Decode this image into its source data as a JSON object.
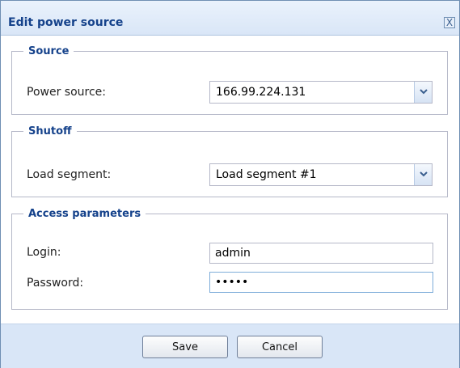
{
  "dialog": {
    "title": "Edit power source",
    "close_glyph": "X",
    "close_icon": "close-icon"
  },
  "source": {
    "legend": "Source",
    "power_source_label": "Power source:",
    "power_source_value": "166.99.224.131",
    "dropdown_icon": "chevron-down-icon"
  },
  "shutoff": {
    "legend": "Shutoff",
    "load_segment_label": "Load segment:",
    "load_segment_value": "Load segment #1",
    "dropdown_icon": "chevron-down-icon"
  },
  "access": {
    "legend": "Access parameters",
    "login_label": "Login:",
    "login_value": "admin",
    "password_label": "Password:",
    "password_value": "•••••"
  },
  "footer": {
    "save_label": "Save",
    "cancel_label": "Cancel"
  },
  "colors": {
    "title_text": "#15428b",
    "header_bg": "#d9e6f7",
    "border": "#b5b8c8"
  }
}
